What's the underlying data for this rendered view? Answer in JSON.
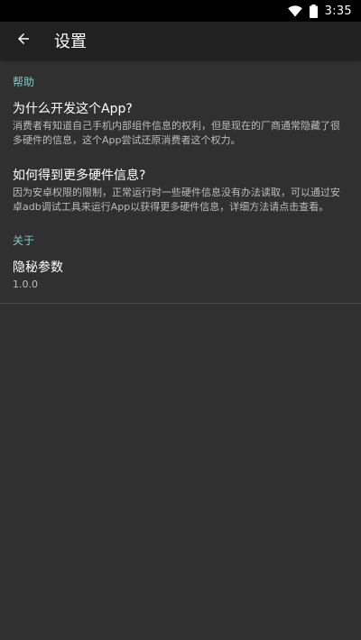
{
  "status_bar": {
    "time": "3:35",
    "icons": [
      "wifi-icon",
      "battery-icon"
    ]
  },
  "app_bar": {
    "title": "设置",
    "back_icon": "arrow-left-icon"
  },
  "sections": {
    "help": {
      "header": "帮助",
      "items": [
        {
          "title": "为什么开发这个App?",
          "summary": "消费者有知道自己手机内部组件信息的权利，但是现在的厂商通常隐藏了很多硬件的信息，这个App尝试还原消费者这个权力。"
        },
        {
          "title": "如何得到更多硬件信息?",
          "summary": "因为安卓权限的限制，正常运行时一些硬件信息没有办法读取，可以通过安卓adb调试工具来运行App以获得更多硬件信息，详细方法请点击查看。"
        }
      ]
    },
    "about": {
      "header": "关于",
      "items": [
        {
          "title": "隐秘参数",
          "summary": "1.0.0"
        }
      ]
    }
  },
  "colors": {
    "accent": "#80cbc4",
    "background": "#303030",
    "app_bar": "#212121",
    "divider": "#454545"
  }
}
